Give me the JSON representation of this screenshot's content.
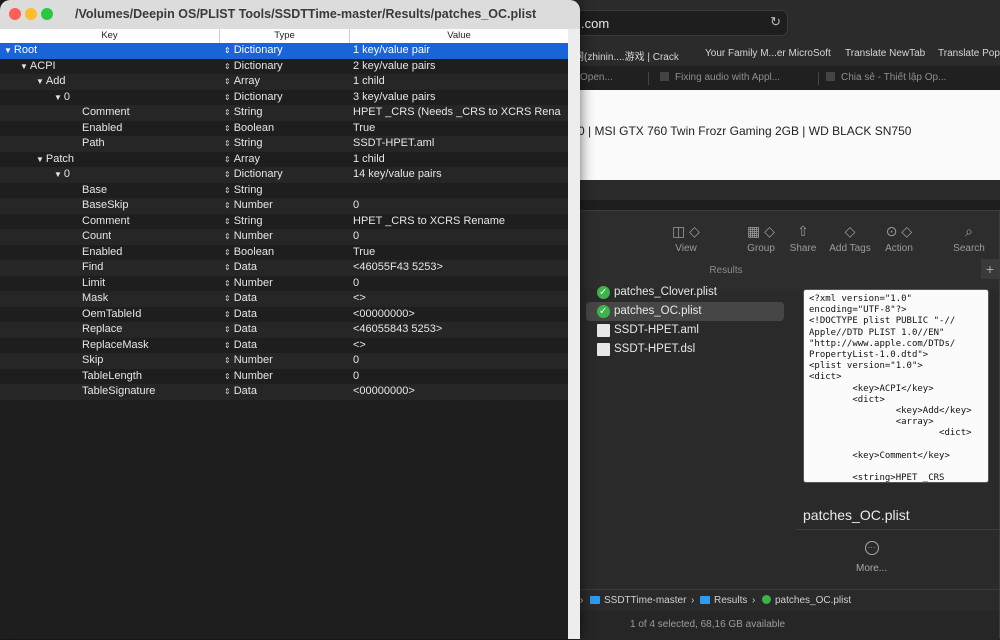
{
  "browser": {
    "url": ".com",
    "reload_icon": "reload-icon",
    "bookmarks": [
      "影网(zhinin....游戏 | Crack",
      "Your Family M...er MicroSoft",
      "Translate NewTab",
      "Translate Pop"
    ],
    "tabs": [
      "Open...",
      "Fixing audio with Appl...",
      "Chia sẻ - Thiết lập Op..."
    ],
    "page_text": "0 | MSI GTX 760 Twin Frozr Gaming 2GB | WD BLACK SN750"
  },
  "finder": {
    "toolbar": [
      {
        "label": "View",
        "icon": "columns-icon"
      },
      {
        "label": "Group",
        "icon": "grid-icon"
      },
      {
        "label": "Share",
        "icon": "share-icon"
      },
      {
        "label": "Add Tags",
        "icon": "tag-icon"
      },
      {
        "label": "Action",
        "icon": "ellipsis-icon"
      },
      {
        "label": "Search",
        "icon": "search-icon"
      }
    ],
    "section_label": "Results",
    "plus_label": "+",
    "files": [
      {
        "name": "patches_Clover.plist",
        "icon": "plist-icon"
      },
      {
        "name": "patches_OC.plist",
        "icon": "plist-icon",
        "selected": true
      },
      {
        "name": "SSDT-HPET.aml",
        "icon": "document-icon"
      },
      {
        "name": "SSDT-HPET.dsl",
        "icon": "document-icon"
      }
    ],
    "preview_text": "<?xml version=\"1.0\"\nencoding=\"UTF-8\"?>\n<!DOCTYPE plist PUBLIC \"-//\nApple//DTD PLIST 1.0//EN\"\n\"http://www.apple.com/DTDs/\nPropertyList-1.0.dtd\">\n<plist version=\"1.0\">\n<dict>\n        <key>ACPI</key>\n        <dict>\n                <key>Add</key>\n                <array>\n                        <dict>\n\n        <key>Comment</key>\n\n        <string>HPET _CRS",
    "preview_title": "patches_OC.plist",
    "more_label": "More...",
    "path": [
      "SSDTTime-master",
      "Results",
      "patches_OC.plist"
    ],
    "status": "1 of 4 selected, 68,16 GB available"
  },
  "plist": {
    "window_title": "/Volumes/Deepin OS/PLIST Tools/SSDTTime-master/Results/patches_OC.plist",
    "columns": {
      "key": "Key",
      "type": "Type",
      "value": "Value"
    },
    "rows": [
      {
        "key": "Root",
        "type": "Dictionary",
        "value": "1 key/value pair"
      },
      {
        "key": "ACPI",
        "type": "Dictionary",
        "value": "2 key/value pairs"
      },
      {
        "key": "Add",
        "type": "Array",
        "value": "1 child"
      },
      {
        "key": "0",
        "type": "Dictionary",
        "value": "3 key/value pairs"
      },
      {
        "key": "Comment",
        "type": "String",
        "value": "HPET _CRS (Needs _CRS to XCRS Rena"
      },
      {
        "key": "Enabled",
        "type": "Boolean",
        "value": "True"
      },
      {
        "key": "Path",
        "type": "String",
        "value": "SSDT-HPET.aml"
      },
      {
        "key": "Patch",
        "type": "Array",
        "value": "1 child"
      },
      {
        "key": "0",
        "type": "Dictionary",
        "value": "14 key/value pairs"
      },
      {
        "key": "Base",
        "type": "String",
        "value": ""
      },
      {
        "key": "BaseSkip",
        "type": "Number",
        "value": "0"
      },
      {
        "key": "Comment",
        "type": "String",
        "value": "HPET _CRS to XCRS Rename"
      },
      {
        "key": "Count",
        "type": "Number",
        "value": "0"
      },
      {
        "key": "Enabled",
        "type": "Boolean",
        "value": "True"
      },
      {
        "key": "Find",
        "type": "Data",
        "value": "<46055F43 5253>"
      },
      {
        "key": "Limit",
        "type": "Number",
        "value": "0"
      },
      {
        "key": "Mask",
        "type": "Data",
        "value": "<>"
      },
      {
        "key": "OemTableId",
        "type": "Data",
        "value": "<00000000>"
      },
      {
        "key": "Replace",
        "type": "Data",
        "value": "<46055843 5253>"
      },
      {
        "key": "ReplaceMask",
        "type": "Data",
        "value": "<>"
      },
      {
        "key": "Skip",
        "type": "Number",
        "value": "0"
      },
      {
        "key": "TableLength",
        "type": "Number",
        "value": "0"
      },
      {
        "key": "TableSignature",
        "type": "Data",
        "value": "<00000000>"
      }
    ]
  }
}
